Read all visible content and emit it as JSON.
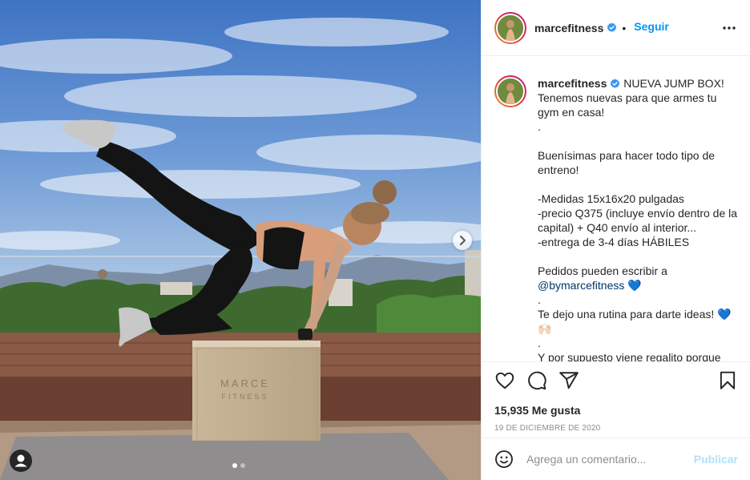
{
  "post": {
    "username": "marcefitness",
    "follow_sep": "•",
    "follow_label": "Seguir",
    "caption_lines": [
      "NUEVA JUMP BOX!",
      "Tenemos nuevas para que armes tu gym en casa!",
      ".",
      "",
      "Buenísimas para hacer todo tipo de entreno!",
      "",
      "-Medidas 15x16x20 pulgadas",
      "-precio Q375 (incluye envío dentro de la capital) + Q40 envío al interior...",
      "-entrega de 3-4 días HÁBILES",
      "",
      "Pedidos pueden escribir a"
    ],
    "mention": "@bymarcefitness",
    "blue_heart": "💙",
    "caption_tail_lines": [
      ".",
      "Te dejo una rutina para darte ideas! 💙🙌🏻",
      ".",
      "Y por supuesto viene regalito porque"
    ],
    "likes": "15,935 Me gusta",
    "date": "19 DE DICIEMBRE DE 2020",
    "comment_placeholder": "Agrega un comentario...",
    "publish_label": "Publicar"
  },
  "photo": {
    "box_brand_line1": "MARCE",
    "box_brand_line2": "FITNESS",
    "carousel": {
      "current": 1,
      "total": 2
    }
  },
  "icons": {
    "verified": "verified-badge-icon",
    "more": "more-options-icon",
    "like": "heart-icon",
    "comment": "comment-icon",
    "share": "paper-plane-icon",
    "save": "bookmark-icon",
    "emoji": "smiley-icon",
    "next": "chevron-right-icon",
    "user_tag": "person-icon"
  },
  "colors": {
    "accent": "#0095f6",
    "publish_disabled": "#b2dffc",
    "mention": "#00376b",
    "muted": "#8e8e8e",
    "text": "#262626"
  }
}
